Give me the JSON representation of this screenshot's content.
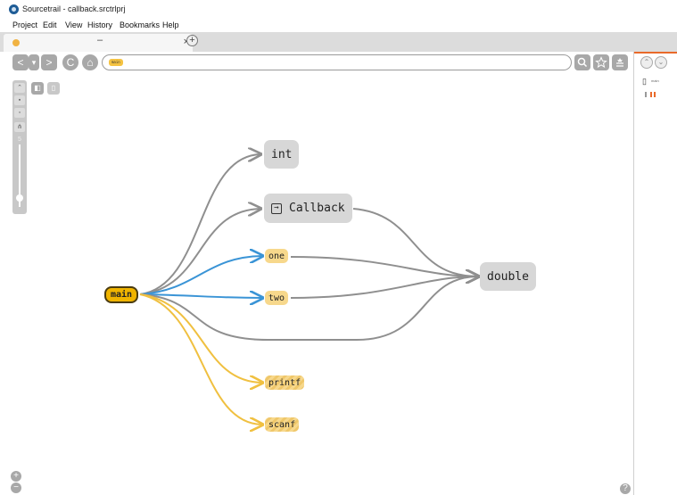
{
  "window": {
    "title": "Sourcetrail - callback.srctrlprj"
  },
  "menu": [
    "Project",
    "Edit",
    "View",
    "History",
    "Bookmarks",
    "Help"
  ],
  "tab": {
    "minimize": "–",
    "close": "×",
    "add": "+"
  },
  "toolbar": {
    "back": "<",
    "forward": ">",
    "refresh": "C",
    "home": "⌂",
    "search_chip": "main",
    "search_placeholder": ""
  },
  "graph_nodes": {
    "main": "main",
    "int": "int",
    "callback": "Callback",
    "one": "one",
    "two": "two",
    "double": "double",
    "printf": "printf",
    "scanf": "scanf"
  },
  "side": {
    "file_label": "main"
  },
  "zoom": {
    "in": "+",
    "out": "−"
  },
  "help": "?",
  "colors": {
    "edge_gray": "#8f8f8f",
    "edge_blue": "#3a94d6",
    "edge_yellow": "#f0c040",
    "accent_orange": "#e96a2a"
  }
}
